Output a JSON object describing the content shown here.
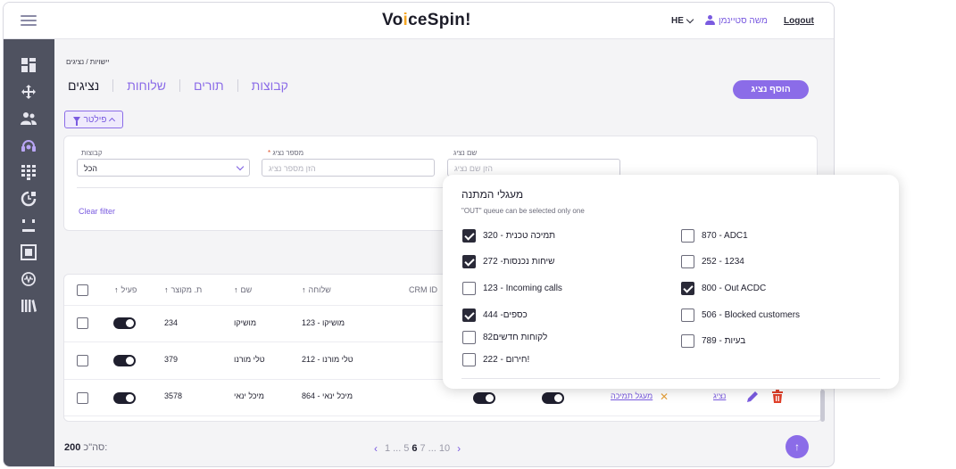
{
  "header": {
    "logo": "VoiceSpin!",
    "language": "HE",
    "user_name": "משה סטיינמן",
    "logout": "Logout"
  },
  "breadcrumb": "יישויות / נציגים",
  "tabs": [
    {
      "label": "נציגים",
      "active": true
    },
    {
      "label": "שלוחות",
      "active": false
    },
    {
      "label": "תורים",
      "active": false
    },
    {
      "label": "קבוצות",
      "active": false
    }
  ],
  "add_button": "הוסף נציג",
  "filter_button": "פילטר",
  "filters": {
    "groups_label": "קבוצות",
    "groups_value": "הכל",
    "agent_no_label": "מספר נציג",
    "agent_no_required": "*",
    "agent_no_placeholder": "הזן מספר נציג",
    "agent_name_label": "שם נציג",
    "agent_name_placeholder": "הזן שם נציג",
    "clear": "Clear filter"
  },
  "table": {
    "headers": {
      "active": "פעיל",
      "short_no": "ת. מקוצר",
      "name": "שם",
      "extension": "שלוחה",
      "crm": "CRM ID"
    },
    "rows": [
      {
        "short_no": "234",
        "name": "מושיקו",
        "extension": "123 - מושיקו"
      },
      {
        "short_no": "379",
        "name": "טלי מורנו",
        "extension": "212 - טלי מורנו"
      },
      {
        "short_no": "3578",
        "name": "מיכל ינאי",
        "extension": "864 - מיכל ינאי",
        "queue_link": "מעגל תמיכה",
        "agent_link": "נציג"
      }
    ]
  },
  "footer": {
    "total_label": "סה\"כ:",
    "total_value": "200",
    "pages": {
      "p1": "1",
      "d1": "...",
      "p5": "5",
      "p6": "6",
      "p7": "7",
      "d2": "...",
      "p10": "10"
    },
    "fab": "↑"
  },
  "popup": {
    "title": "מעגלי המתנה",
    "subtitle": "\"OUT\" queue can be selected only one",
    "left_items": [
      {
        "label": "320 - תמיכה טכנית",
        "checked": true
      },
      {
        "label": "272 -שיחות נכנסות",
        "checked": true
      },
      {
        "label": "123 - Incoming calls",
        "checked": false
      },
      {
        "label": "444 -כספים",
        "checked": true
      },
      {
        "label": "82לקוחות חדשים",
        "checked": false
      },
      {
        "label": "222 - חירום!",
        "checked": false
      }
    ],
    "right_items": [
      {
        "label": "870 - ADC1",
        "checked": false
      },
      {
        "label": "252 - 1234",
        "checked": false
      },
      {
        "label": "800 - Out ACDC",
        "checked": true
      },
      {
        "label": "506 - Blocked customers",
        "checked": false
      },
      {
        "label": "789 - בעיות",
        "checked": false
      }
    ]
  },
  "colors": {
    "accent": "#8b6ce8",
    "sidebar": "#4f5260",
    "dark": "#1f1f2e",
    "warning": "#e6a23c",
    "danger": "#e0402a"
  }
}
